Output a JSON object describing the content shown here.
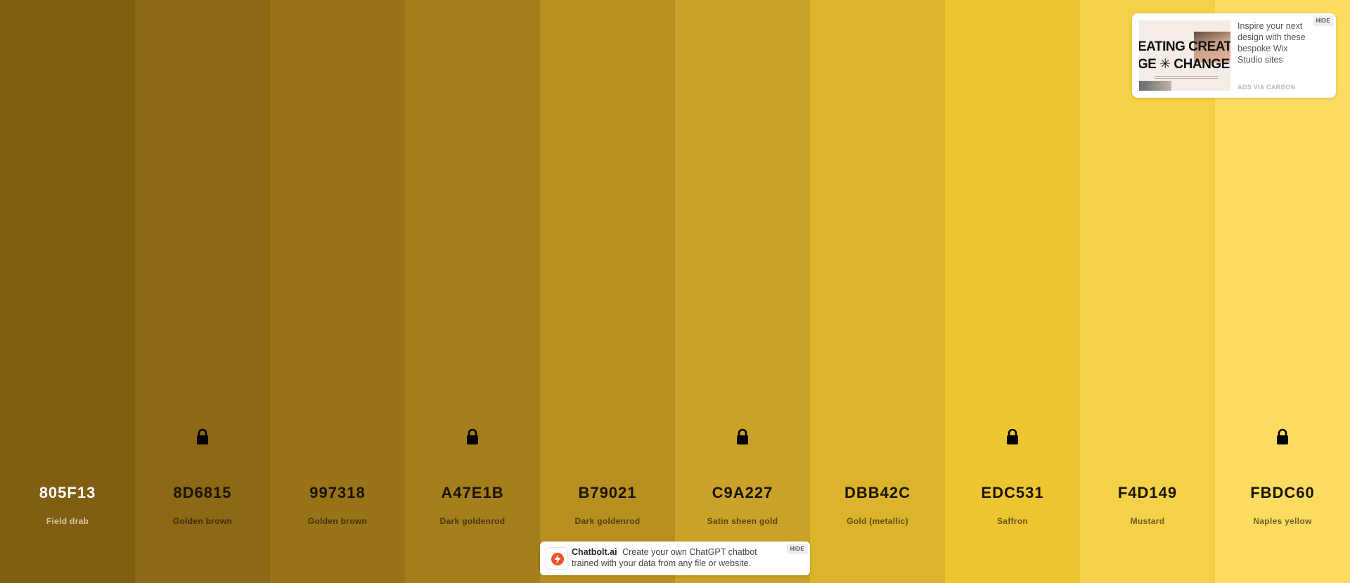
{
  "palette": [
    {
      "hex": "805F13",
      "name": "Field drab",
      "bg": "#805F13",
      "text": "#FFFFFF",
      "subtext": "#D8C8A0",
      "locked": false
    },
    {
      "hex": "8D6815",
      "name": "Golden brown",
      "bg": "#8D6815",
      "text": "#1A1305",
      "subtext": "#3E2E0A",
      "locked": true
    },
    {
      "hex": "997318",
      "name": "Golden brown",
      "bg": "#997318",
      "text": "#1A1305",
      "subtext": "#43320C",
      "locked": false
    },
    {
      "hex": "A47E1B",
      "name": "Dark goldenrod",
      "bg": "#A47E1B",
      "text": "#1A1305",
      "subtext": "#47370D",
      "locked": true
    },
    {
      "hex": "B79021",
      "name": "Dark goldenrod",
      "bg": "#B79021",
      "text": "#1A1305",
      "subtext": "#503F10",
      "locked": false
    },
    {
      "hex": "C9A227",
      "name": "Satin sheen gold",
      "bg": "#C9A227",
      "text": "#1A1305",
      "subtext": "#584611",
      "locked": true
    },
    {
      "hex": "DBB42C",
      "name": "Gold (metallic)",
      "bg": "#DBB42C",
      "text": "#1A1305",
      "subtext": "#604E13",
      "locked": false
    },
    {
      "hex": "EDC531",
      "name": "Saffron",
      "bg": "#EDC531",
      "text": "#1A1305",
      "subtext": "#685615",
      "locked": true
    },
    {
      "hex": "F4D149",
      "name": "Mustard",
      "bg": "#F4D149",
      "text": "#1A1305",
      "subtext": "#6B5B20",
      "locked": false
    },
    {
      "hex": "FBDC60",
      "name": "Naples yellow",
      "bg": "#FBDC60",
      "text": "#1A1305",
      "subtext": "#6E602A",
      "locked": true
    }
  ],
  "ad": {
    "image_line_1": "EATING CREAT",
    "image_line_2": "GE ✳ CHANGE",
    "text": "Inspire your next design with these bespoke Wix Studio sites",
    "via": "ADS VIA CARBON",
    "hide": "HIDE"
  },
  "banner": {
    "brand": "Chatbolt.ai",
    "text": "Create your own ChatGPT chatbot trained with your data from any file or website.",
    "hide": "HIDE",
    "icon": "lightning-bolt-icon",
    "icon_color": "#F0512A"
  }
}
